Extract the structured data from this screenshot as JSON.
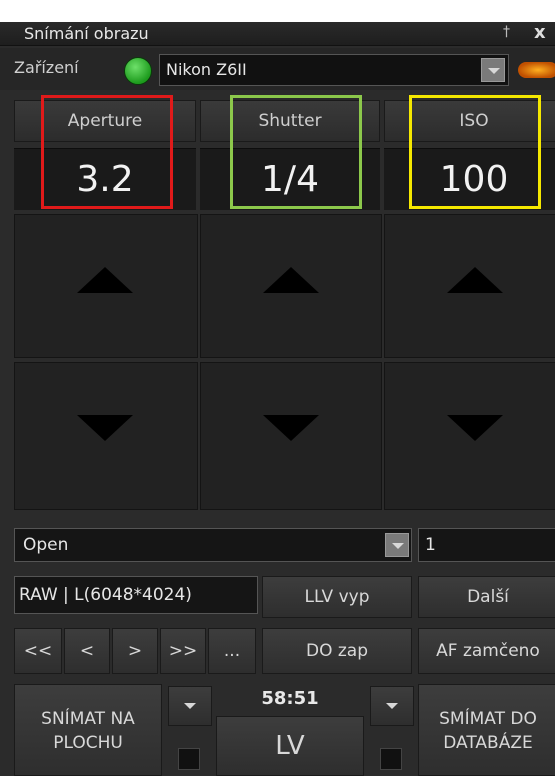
{
  "window": {
    "title": "Snímání obrazu",
    "pin_glyph": "†",
    "close_glyph": "x"
  },
  "device": {
    "label": "Zařízení",
    "selected": "Nikon Z6II",
    "status_color": "#2aa82a"
  },
  "params": {
    "aperture": {
      "label": "Aperture",
      "value": "3.2",
      "highlight": "#e01a1a"
    },
    "shutter": {
      "label": "Shutter",
      "value": "1/4",
      "highlight": "#8cc84b"
    },
    "iso": {
      "label": "ISO",
      "value": "100",
      "highlight": "#f5e800"
    }
  },
  "mode": {
    "selected": "Open",
    "count": "1"
  },
  "format": {
    "value": "RAW | L(6048*4024)"
  },
  "buttons": {
    "llv": "LLV vyp",
    "next": "Další",
    "first": "<<",
    "prev": "<",
    "fwd": ">",
    "last": ">>",
    "more": "...",
    "do": "DO zap",
    "af": "AF zamčeno",
    "capture_desktop": "SNÍMAT NA PLOCHU",
    "capture_db": "SMÍMAT DO DATABÁZE",
    "lv": "LV"
  },
  "timer": "58:51"
}
